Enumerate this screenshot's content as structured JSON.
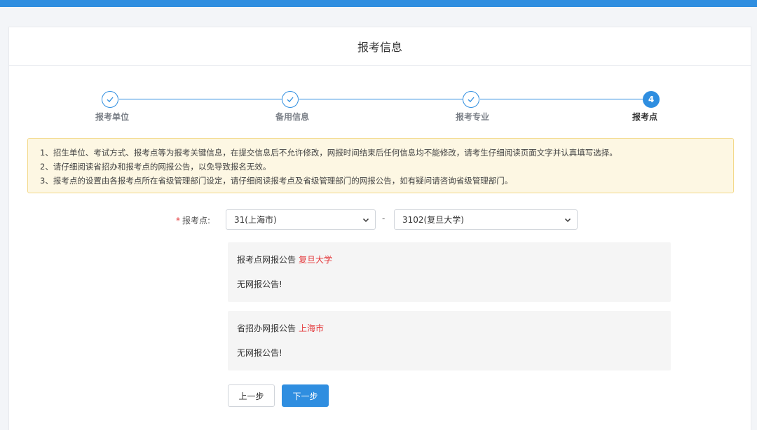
{
  "header": {
    "title": "报考信息"
  },
  "steps": [
    {
      "label": "报考单位",
      "state": "done",
      "icon": "check-icon"
    },
    {
      "label": "备用信息",
      "state": "done",
      "icon": "check-icon"
    },
    {
      "label": "报考专业",
      "state": "done",
      "icon": "check-icon"
    },
    {
      "label": "报考点",
      "state": "active",
      "number": "4"
    }
  ],
  "notice": {
    "lines": [
      "1、招生单位、考试方式、报考点等为报考关键信息，在提交信息后不允许修改，网报时间结束后任何信息均不能修改，请考生仔细阅读页面文字并认真填写选择。",
      "2、请仔细阅读省招办和报考点的网报公告，以免导致报名无效。",
      "3、报考点的设置由各报考点所在省级管理部门设定，请仔细阅读报考点及省级管理部门的网报公告，如有疑问请咨询省级管理部门。"
    ]
  },
  "form": {
    "required_mark": "*",
    "label": "报考点:",
    "province_select": "31(上海市)",
    "separator": "-",
    "site_select": "3102(复旦大学)"
  },
  "announcements": {
    "site": {
      "title": "报考点网报公告",
      "highlight": "复旦大学",
      "body": "无网报公告!"
    },
    "province": {
      "title": "省招办网报公告",
      "highlight": "上海市",
      "body": "无网报公告!"
    }
  },
  "buttons": {
    "prev": "上一步",
    "next": "下一步"
  },
  "colors": {
    "accent": "#2f8ee0",
    "highlight": "#e4393c",
    "notice_bg": "#fdf7e3",
    "notice_border": "#f3d98a"
  }
}
